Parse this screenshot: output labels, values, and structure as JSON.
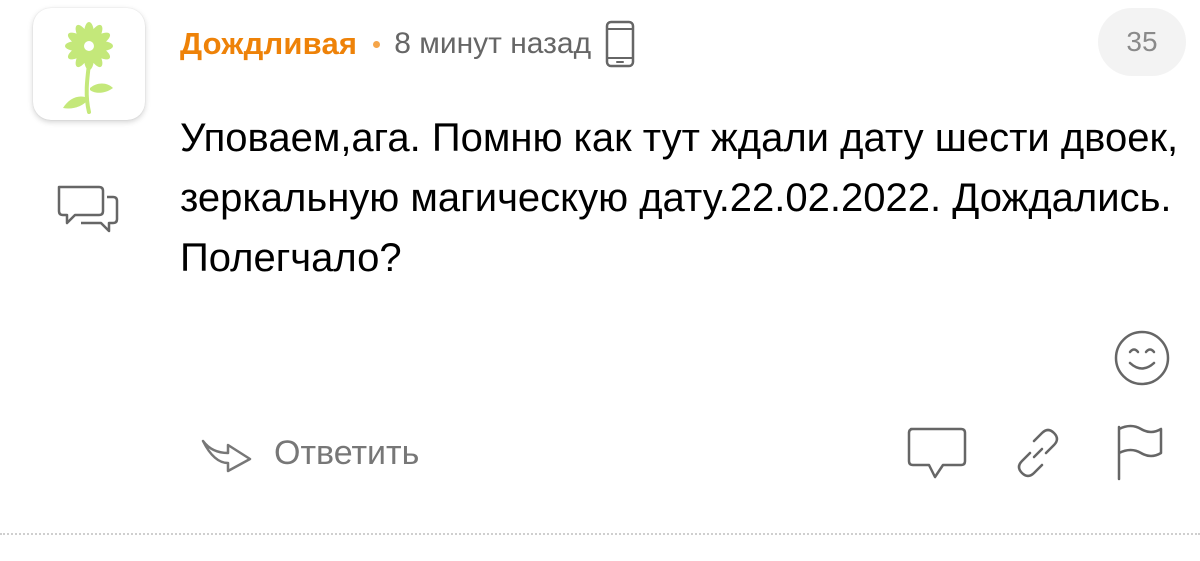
{
  "comment": {
    "author": "Дождливая",
    "time": "8 минут назад",
    "count": "35",
    "text": "Уповаем,ага. Помню как тут ждали дату шести двоек, зеркальную магическую дату.22.02.2022. Дождались. Полегчало?",
    "reply_label": "Ответить"
  },
  "icons": {
    "avatar": "flower-avatar",
    "thread": "speech-bubbles-icon",
    "device": "smartphone-icon",
    "reaction": "smile-icon",
    "reply": "reply-arrow-icon",
    "comment": "comment-icon",
    "link": "link-icon",
    "flag": "flag-icon"
  },
  "colors": {
    "author": "#ee8208",
    "text": "#000000",
    "muted": "#777777",
    "badge_bg": "#f3f3f3",
    "avatar_flower": "#c4e87a"
  }
}
